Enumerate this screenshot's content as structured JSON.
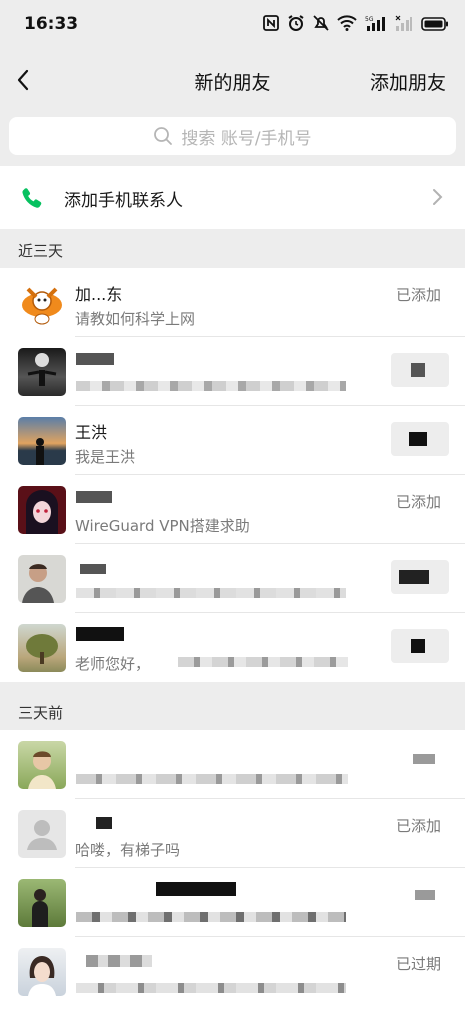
{
  "status_bar": {
    "time": "16:33"
  },
  "nav": {
    "title": "新的朋友",
    "right_action": "添加朋友"
  },
  "search": {
    "placeholder": "搜索 账号/手机号"
  },
  "phone_contacts": {
    "label": "添加手机联系人"
  },
  "sections": [
    {
      "label": "近三天"
    },
    {
      "label": "三天前"
    }
  ],
  "recent": [
    {
      "name": "加...东",
      "message": "请教如何科学上网",
      "status": "已添加"
    },
    {
      "name": "",
      "message": "",
      "status": ""
    },
    {
      "name": "王洪",
      "message": "我是王洪",
      "status": ""
    },
    {
      "name": "",
      "message": "WireGuard VPN搭建求助",
      "status": "已添加"
    },
    {
      "name": "",
      "message": "",
      "status": ""
    },
    {
      "name": "",
      "message": "老师您好，",
      "status": ""
    }
  ],
  "earlier": [
    {
      "name": "",
      "message": "",
      "status": ""
    },
    {
      "name": "",
      "message": "哈喽，有梯子吗",
      "status": "已添加"
    },
    {
      "name": "",
      "message": "",
      "status": ""
    },
    {
      "name": "",
      "message": "",
      "status": "已过期"
    }
  ],
  "colors": {
    "accent_green": "#07c160",
    "background": "#ededed"
  }
}
